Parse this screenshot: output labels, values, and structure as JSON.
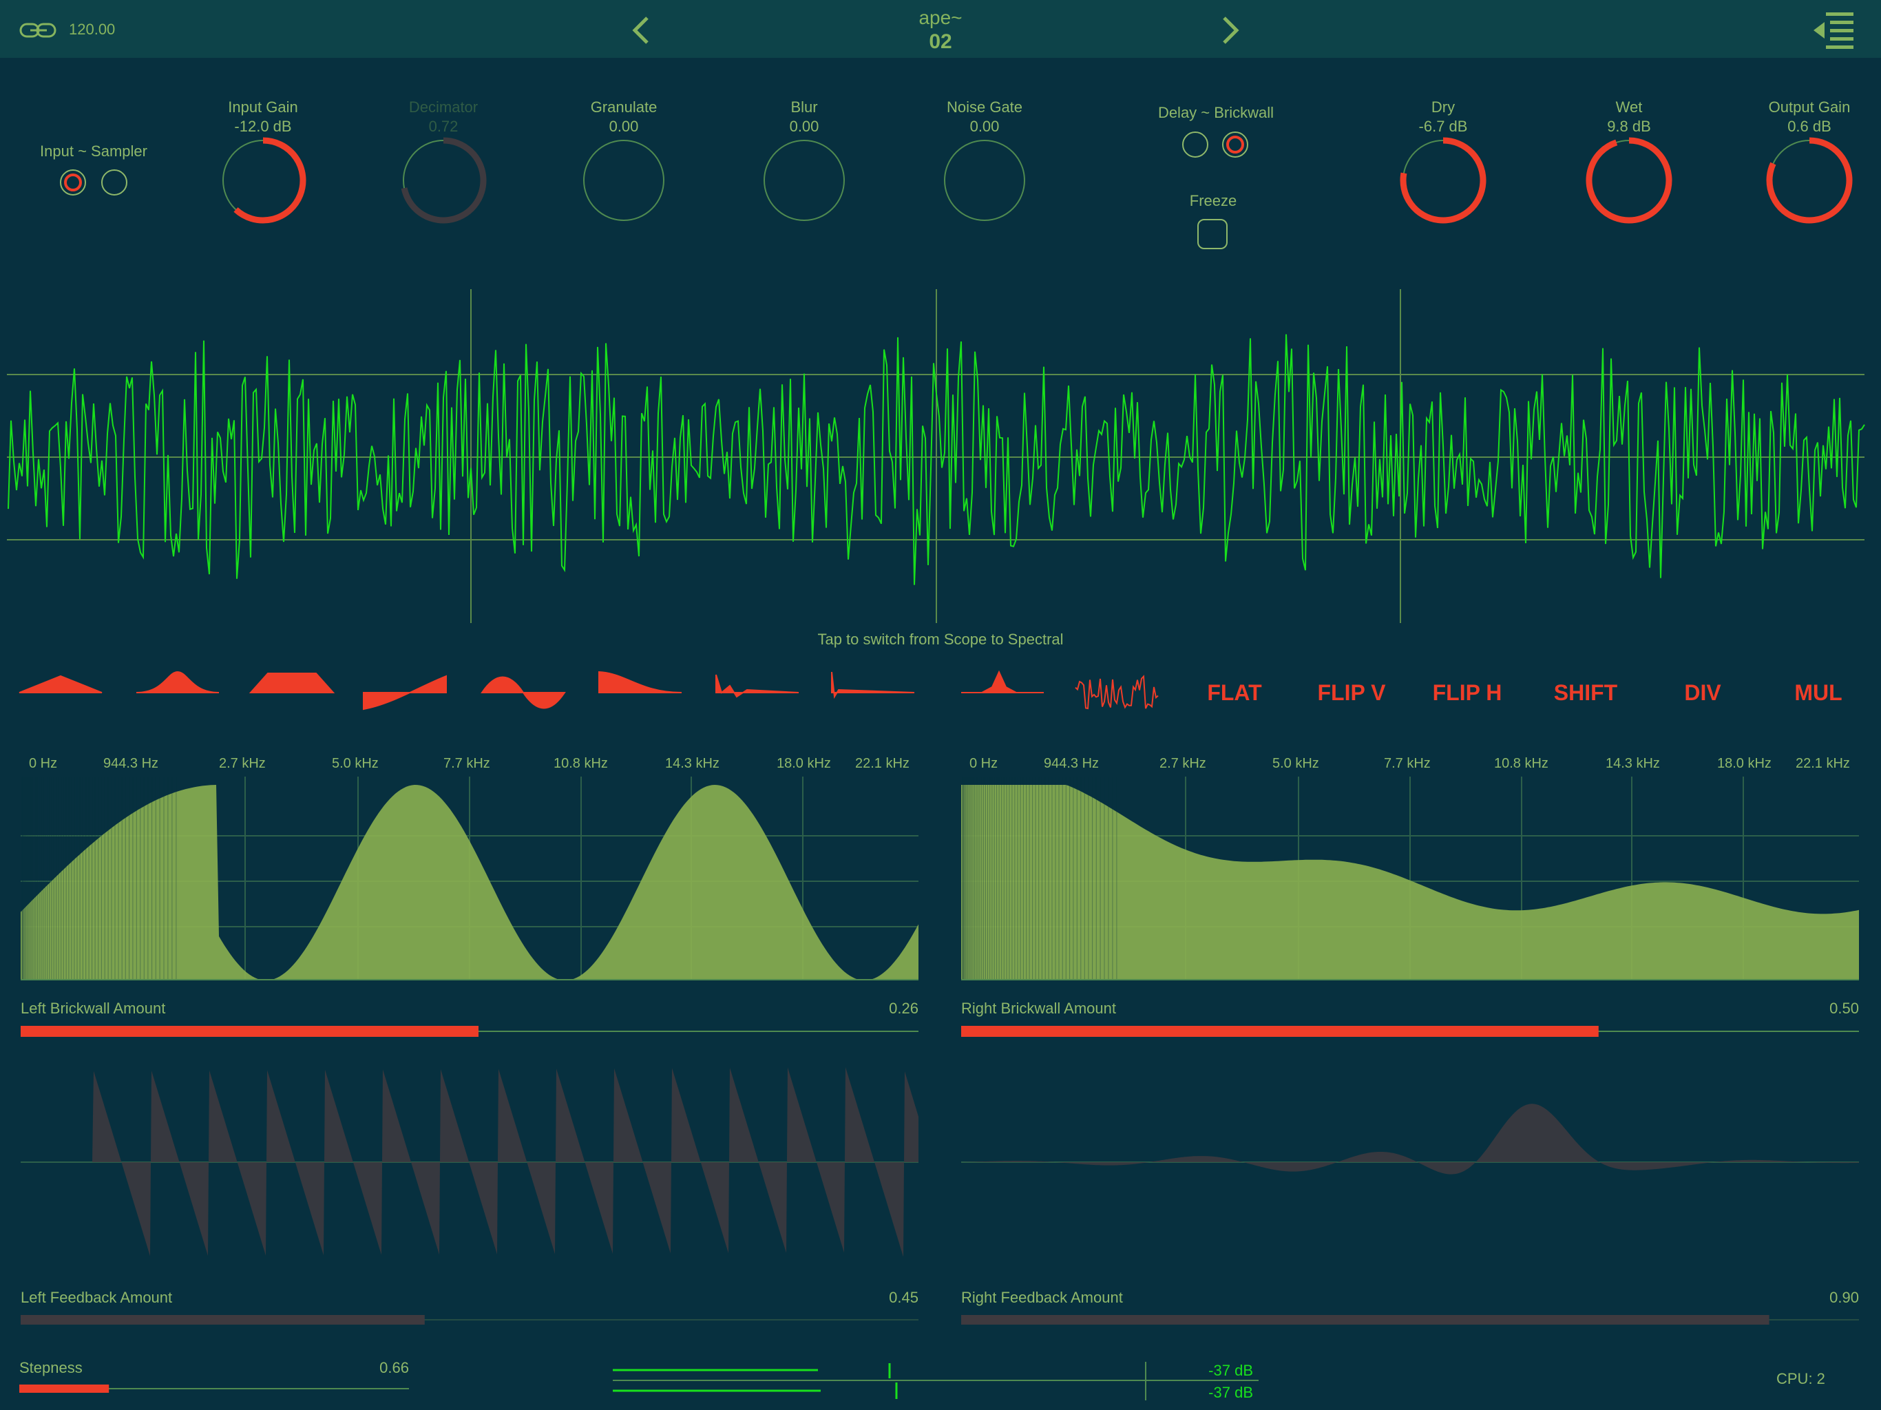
{
  "header": {
    "tempo": "120.00",
    "preset_name": "ape~",
    "preset_number": "02",
    "icons": {
      "link": "link-icon",
      "prev": "chevron-left-icon",
      "next": "chevron-right-icon",
      "menu": "menu-list-icon"
    }
  },
  "knobs": {
    "input_sampler": {
      "label": "Input ~ Sampler"
    },
    "input_gain": {
      "label": "Input Gain",
      "value": "-12.0 dB",
      "level": 0.62
    },
    "decimator": {
      "label": "Decimator",
      "value": "0.72",
      "level": 0.72
    },
    "granulate": {
      "label": "Granulate",
      "value": "0.00",
      "level": 0
    },
    "blur": {
      "label": "Blur",
      "value": "0.00",
      "level": 0
    },
    "noise_gate": {
      "label": "Noise Gate",
      "value": "0.00",
      "level": 0
    },
    "delay_brickwall": {
      "label": "Delay ~ Brickwall"
    },
    "freeze": {
      "label": "Freeze"
    },
    "dry": {
      "label": "Dry",
      "value": "-6.7 dB",
      "level": 0.78
    },
    "wet": {
      "label": "Wet",
      "value": "9.8 dB",
      "level": 0.95
    },
    "output_gain": {
      "label": "Output Gain",
      "value": "0.6 dB",
      "level": 0.82
    }
  },
  "scope": {
    "hint": "Tap to switch from Scope to Spectral"
  },
  "operations": [
    "FLAT",
    "FLIP V",
    "FLIP H",
    "SHIFT",
    "DIV",
    "MUL"
  ],
  "shape_icons": [
    "triangle-shape-icon",
    "gaussian-shape-icon",
    "trapezoid-shape-icon",
    "ramp-shape-icon",
    "sine-shape-icon",
    "decay-shape-icon",
    "damped-shape-icon",
    "impulse-shape-icon",
    "wavelet-shape-icon",
    "noise-shape-icon"
  ],
  "freq_axis": [
    "0 Hz",
    "944.3 Hz",
    "2.7 kHz",
    "5.0 kHz",
    "7.7 kHz",
    "10.8 kHz",
    "14.3 kHz",
    "18.0 kHz",
    "22.1 kHz"
  ],
  "sliders": {
    "left_brickwall": {
      "label": "Left Brickwall Amount",
      "value": "0.26",
      "level": 0.51
    },
    "right_brickwall": {
      "label": "Right Brickwall Amount",
      "value": "0.50",
      "level": 0.71
    },
    "left_feedback": {
      "label": "Left Feedback Amount",
      "value": "0.45",
      "level": 0.45
    },
    "right_feedback": {
      "label": "Right Feedback Amount",
      "value": "0.90",
      "level": 0.9
    },
    "stepness": {
      "label": "Stepness",
      "value": "0.66",
      "level": 0.23
    }
  },
  "meters": {
    "top_db": "-37 dB",
    "bottom_db": "-37 dB"
  },
  "cpu": "CPU: 2",
  "colors": {
    "background": "#07303f",
    "accent": "#ee3d28",
    "text": "#8fb86a",
    "wave": "#19e01c",
    "fill": "#8bb050",
    "dim_fill": "#3e3a3f"
  }
}
